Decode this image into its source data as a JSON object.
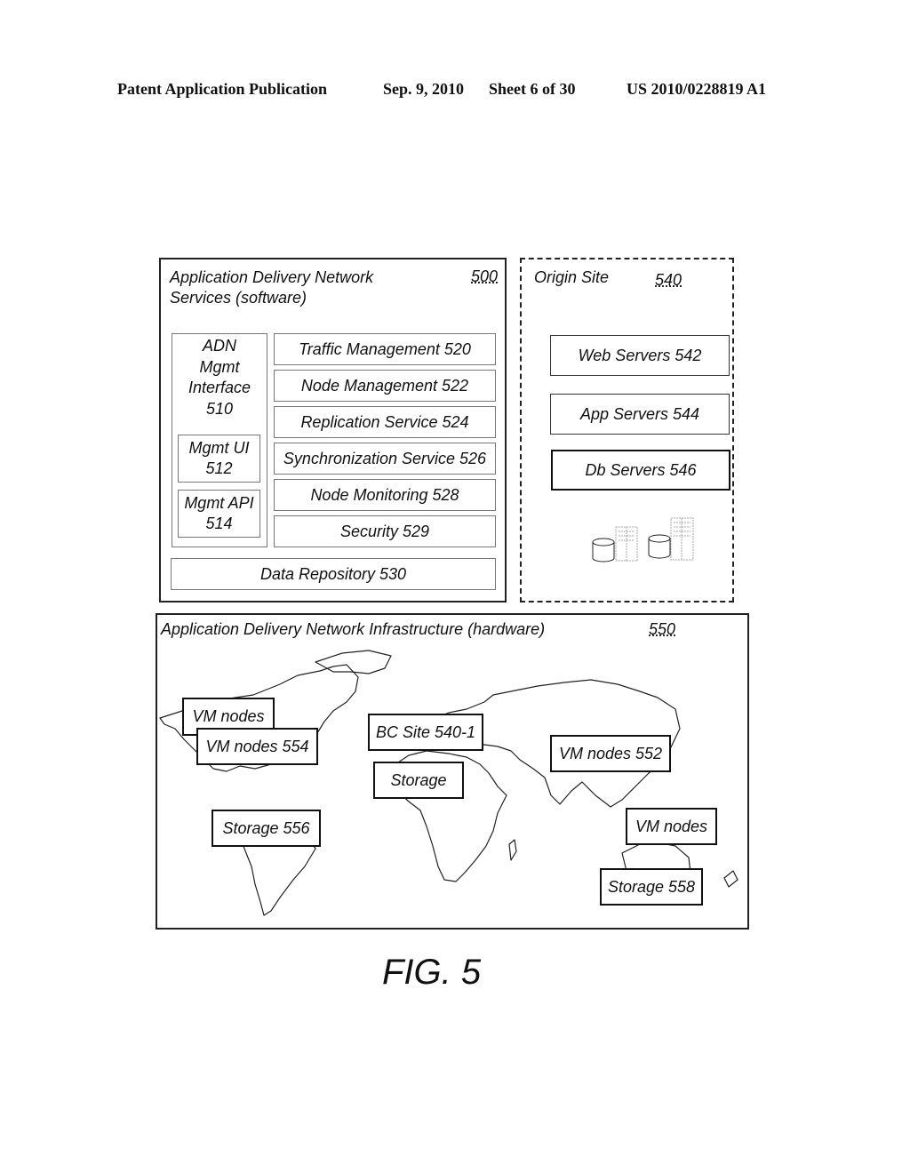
{
  "header": {
    "publication": "Patent Application Publication",
    "date": "Sep. 9, 2010",
    "sheet": "Sheet 6 of 30",
    "patent_number": "US 2010/0228819 A1"
  },
  "software_block": {
    "title_line1": "Application Delivery Network",
    "title_line2": "Services (software)",
    "ref": "500",
    "mgmt_interface": {
      "lines": [
        "ADN",
        "Mgmt",
        "Interface",
        "510"
      ],
      "ui": {
        "line1": "Mgmt UI",
        "line2": "512"
      },
      "api": {
        "line1": "Mgmt API",
        "line2": "514"
      }
    },
    "services": [
      "Traffic Management  520",
      "Node Management  522",
      "Replication Service  524",
      "Synchronization Service 526",
      "Node Monitoring  528",
      "Security  529"
    ],
    "data_repository": "Data Repository  530"
  },
  "origin_site": {
    "title": "Origin Site",
    "ref": "540",
    "servers": [
      "Web Servers 542",
      "App Servers 544",
      "Db Servers 546"
    ]
  },
  "hardware_block": {
    "title": "Application Delivery Network Infrastructure (hardware)",
    "ref": "550",
    "map_labels": {
      "vm_nodes_na": "VM nodes",
      "vm_nodes_554": "VM nodes 554",
      "bc_site": "BC Site 540-1",
      "storage_africa": "Storage",
      "vm_nodes_552": "VM nodes 552",
      "storage_556": "Storage 556",
      "vm_nodes_asia": "VM nodes",
      "storage_558": "Storage 558"
    }
  },
  "figure_caption": "FIG. 5"
}
